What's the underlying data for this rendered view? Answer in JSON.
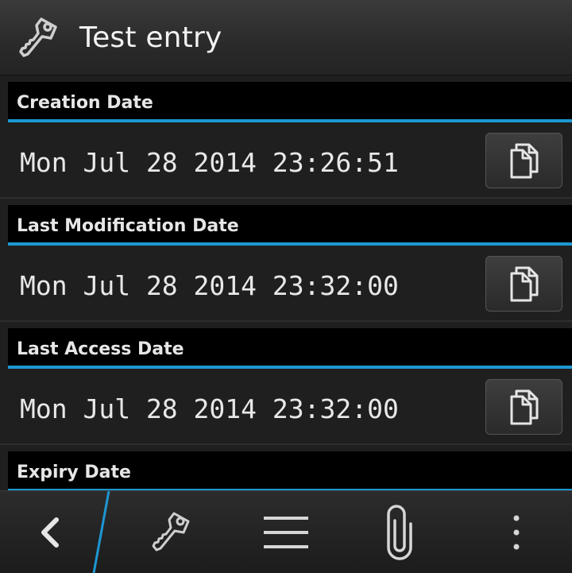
{
  "header": {
    "title": "Test entry",
    "icon": "key-icon"
  },
  "sections": [
    {
      "label": "Creation Date",
      "value": "Mon Jul 28 2014 23:26:51"
    },
    {
      "label": "Last Modification Date",
      "value": "Mon Jul 28 2014 23:32:00"
    },
    {
      "label": "Last Access Date",
      "value": "Mon Jul 28 2014 23:32:00"
    },
    {
      "label": "Expiry Date"
    }
  ],
  "toolbar": {
    "items": [
      "back-icon",
      "key-icon",
      "menu-icon",
      "paperclip-icon",
      "overflow-icon"
    ]
  },
  "colors": {
    "accent": "#1d97d3",
    "background": "#1f1f1f",
    "header_bg": "#000000"
  }
}
